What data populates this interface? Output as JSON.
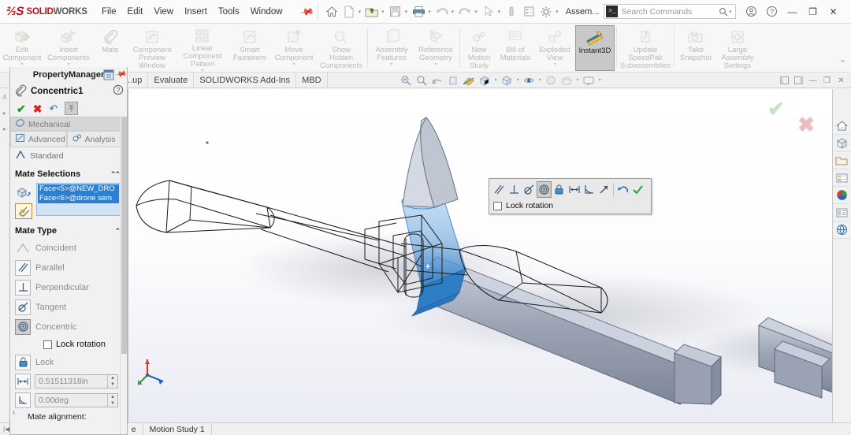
{
  "app": {
    "brand_solid": "SOLID",
    "brand_works": "WORKS",
    "brand_mark": "⅔S",
    "document_name": "Assem...",
    "accent_red": "#b4151c",
    "accent_blue": "#2f7fd0",
    "selection_blue": "#cfe4f7"
  },
  "menu": {
    "items": [
      {
        "label": "File"
      },
      {
        "label": "Edit"
      },
      {
        "label": "View"
      },
      {
        "label": "Insert"
      },
      {
        "label": "Tools"
      },
      {
        "label": "Window"
      }
    ],
    "pin_icon": "pushpin-icon"
  },
  "quickaccess": {
    "buttons": [
      {
        "name": "home-icon",
        "label": "Home",
        "caret": false
      },
      {
        "name": "new-document-icon",
        "label": "New",
        "caret": true
      },
      {
        "name": "open-folder-icon",
        "label": "Open",
        "caret": true
      },
      {
        "name": "save-icon",
        "label": "Save",
        "caret": true
      },
      {
        "name": "print-icon",
        "label": "Print",
        "caret": true
      },
      {
        "name": "undo-icon",
        "label": "Undo",
        "caret": true
      },
      {
        "name": "redo-icon",
        "label": "Redo",
        "caret": true
      },
      {
        "name": "select-arrow-icon",
        "label": "Select",
        "caret": true
      },
      {
        "name": "rebuild-icon",
        "label": "Rebuild",
        "caret": false
      },
      {
        "name": "file-properties-icon",
        "label": "File Properties",
        "caret": false
      },
      {
        "name": "options-gear-icon",
        "label": "Options",
        "caret": true
      }
    ]
  },
  "search": {
    "placeholder": "Search Commands",
    "prompt_glyph": "▶_",
    "magnifier": "search-icon",
    "caret": "▾"
  },
  "window_controls": {
    "account": "user-account-icon",
    "help": "help-icon",
    "minimize": "minimize-icon",
    "restore": "restore-icon",
    "close": "close-icon"
  },
  "ribbon": {
    "groups": [
      {
        "buttons": [
          {
            "name": "edit-component-button",
            "label": "Edit\nComponent",
            "icon": "edit-component-icon",
            "dropdown": true,
            "active": false
          },
          {
            "name": "insert-components-button",
            "label": "Insert\nComponents",
            "icon": "insert-components-icon",
            "dropdown": true,
            "active": false
          },
          {
            "name": "mate-button",
            "label": "Mate",
            "icon": "mate-paperclip-icon",
            "dropdown": false,
            "active": false
          },
          {
            "name": "component-preview-window-button",
            "label": "Component\nPreview\nWindow",
            "icon": "component-preview-icon",
            "dropdown": false,
            "active": false
          },
          {
            "name": "linear-component-pattern-button",
            "label": "Linear Component\nPattern",
            "icon": "linear-pattern-icon",
            "dropdown": true,
            "active": false
          },
          {
            "name": "smart-fasteners-button",
            "label": "Smart\nFasteners",
            "icon": "smart-fasteners-icon",
            "dropdown": false,
            "active": false
          },
          {
            "name": "move-component-button",
            "label": "Move\nComponent",
            "icon": "move-component-icon",
            "dropdown": true,
            "active": false
          },
          {
            "name": "show-hidden-components-button",
            "label": "Show\nHidden\nComponents",
            "icon": "show-hidden-icon",
            "dropdown": false,
            "active": false
          }
        ]
      },
      {
        "buttons": [
          {
            "name": "assembly-features-button",
            "label": "Assembly\nFeatures",
            "icon": "assembly-features-icon",
            "dropdown": true,
            "active": false
          },
          {
            "name": "reference-geometry-button",
            "label": "Reference\nGeometry",
            "icon": "reference-geometry-icon",
            "dropdown": true,
            "active": false
          }
        ]
      },
      {
        "buttons": [
          {
            "name": "new-motion-study-button",
            "label": "New\nMotion\nStudy",
            "icon": "motion-study-icon",
            "dropdown": false,
            "active": false
          },
          {
            "name": "bill-of-materials-button",
            "label": "Bill of\nMaterials",
            "icon": "bom-icon",
            "dropdown": false,
            "active": false
          },
          {
            "name": "exploded-view-button",
            "label": "Exploded\nView",
            "icon": "exploded-view-icon",
            "dropdown": true,
            "active": false
          },
          {
            "name": "instant3d-button",
            "label": "Instant3D",
            "icon": "instant3d-icon",
            "dropdown": false,
            "active": true
          }
        ]
      },
      {
        "buttons": [
          {
            "name": "update-speedpak-subassemblies-button",
            "label": "Update\nSpeedPak\nSubassemblies",
            "icon": "speedpak-icon",
            "dropdown": false,
            "active": false
          }
        ]
      },
      {
        "buttons": [
          {
            "name": "take-snapshot-button",
            "label": "Take\nSnapshot",
            "icon": "camera-icon",
            "dropdown": false,
            "active": false
          },
          {
            "name": "large-assembly-settings-button",
            "label": "Large\nAssembly\nSettings",
            "icon": "large-assembly-icon",
            "dropdown": false,
            "active": false
          }
        ]
      }
    ],
    "collapse_chevron": "⌃"
  },
  "command_tabs": {
    "tabs": [
      {
        "name": "tab-layout",
        "label": "...up"
      },
      {
        "name": "tab-evaluate",
        "label": "Evaluate"
      },
      {
        "name": "tab-solidworks-addins",
        "label": "SOLIDWORKS Add-Ins"
      },
      {
        "name": "tab-mbd",
        "label": "MBD"
      }
    ],
    "view_tools": [
      {
        "name": "zoom-to-fit-icon",
        "caret": false
      },
      {
        "name": "zoom-to-area-icon",
        "caret": false
      },
      {
        "name": "rotate-view-icon",
        "caret": false
      },
      {
        "name": "previous-view-icon",
        "caret": false
      },
      {
        "name": "section-view-icon",
        "caret": false
      },
      {
        "name": "view-orientation-icon",
        "caret": true
      },
      {
        "name": "display-style-icon",
        "caret": true
      },
      {
        "name": "hide-show-items-icon",
        "caret": true
      },
      {
        "name": "edit-appearance-icon",
        "caret": false
      },
      {
        "name": "apply-scene-icon",
        "caret": true
      },
      {
        "name": "view-settings-icon",
        "caret": true
      }
    ],
    "doc_window_controls": [
      {
        "name": "tile-left-icon"
      },
      {
        "name": "tile-right-icon"
      },
      {
        "name": "doc-minimize-icon",
        "glyph": "—"
      },
      {
        "name": "doc-restore-icon",
        "glyph": "❐"
      },
      {
        "name": "doc-close-icon",
        "glyph": "✕"
      }
    ]
  },
  "property_manager": {
    "header": "PropertyManager",
    "feature_name": "Concentric1",
    "feature_icon": "mate-paperclip-icon",
    "header_icons": {
      "display": "pm-display-icon",
      "pin": "pushpin-icon",
      "help": "help-question-icon"
    },
    "actions": [
      {
        "name": "accept-button",
        "glyph": "✔",
        "title": "OK"
      },
      {
        "name": "cancel-button",
        "glyph": "✖",
        "title": "Cancel"
      },
      {
        "name": "undo-button",
        "glyph": "↶",
        "title": "Undo"
      },
      {
        "name": "keep-visible-button",
        "glyph": "📌",
        "title": "Keep Visible"
      }
    ],
    "mate_tabs": [
      {
        "name": "tab-mechanical",
        "label": "Mechanical",
        "selected": true
      },
      {
        "name": "tab-advanced",
        "label": "Advanced",
        "selected": false
      },
      {
        "name": "tab-analysis",
        "label": "Analysis",
        "selected": false
      },
      {
        "name": "tab-standard",
        "label": "Standard",
        "selected": false
      }
    ],
    "mate_selections": {
      "title": "Mate Selections",
      "entities": [
        {
          "name": "mate-entity-1",
          "label": "Face<5>@NEW_DRO"
        },
        {
          "name": "mate-entity-2",
          "label": "Face<6>@drone sem"
        }
      ]
    },
    "mate_type": {
      "title": "Mate Type",
      "items": [
        {
          "name": "mate-coincident",
          "label": "Coincident",
          "icon": "coincident-icon",
          "selected": false,
          "boxed": false
        },
        {
          "name": "mate-parallel",
          "label": "Parallel",
          "icon": "parallel-icon",
          "selected": false,
          "boxed": true
        },
        {
          "name": "mate-perpendicular",
          "label": "Perpendicular",
          "icon": "perpendicular-icon",
          "selected": false,
          "boxed": true
        },
        {
          "name": "mate-tangent",
          "label": "Tangent",
          "icon": "tangent-icon",
          "selected": false,
          "boxed": true
        },
        {
          "name": "mate-concentric",
          "label": "Concentric",
          "icon": "concentric-icon",
          "selected": true,
          "boxed": true
        }
      ],
      "lock_rotation": {
        "label": "Lock rotation",
        "checked": false
      },
      "lock": {
        "label": "Lock",
        "icon": "padlock-icon"
      },
      "distance": {
        "value": "0.51511318in",
        "icon": "distance-icon"
      },
      "angle": {
        "value": "0.00deg",
        "icon": "angle-icon"
      },
      "mate_alignment_label": "Mate alignment:"
    }
  },
  "context_toolbar": {
    "buttons": [
      {
        "name": "ctx-parallel",
        "icon": "parallel-icon",
        "active": false
      },
      {
        "name": "ctx-perpendicular",
        "icon": "perpendicular-icon",
        "active": false
      },
      {
        "name": "ctx-tangent",
        "icon": "tangent-icon",
        "active": false
      },
      {
        "name": "ctx-concentric",
        "icon": "concentric-icon",
        "active": true
      },
      {
        "name": "ctx-lock",
        "icon": "padlock-icon",
        "active": false
      },
      {
        "name": "ctx-distance",
        "icon": "distance-icon",
        "active": false
      },
      {
        "name": "ctx-angle",
        "icon": "angle-icon",
        "active": false
      },
      {
        "name": "ctx-align",
        "icon": "align-arrow-icon",
        "active": false
      },
      {
        "name": "ctx-undo",
        "icon": "undo-icon",
        "active": false
      },
      {
        "name": "ctx-accept",
        "icon": "checkmark-icon",
        "active": false
      }
    ],
    "lock_rotation": {
      "label": "Lock rotation",
      "checked": false
    }
  },
  "graphics": {
    "confirm_ok": "✔",
    "confirm_cancel": "✖",
    "triad": {
      "x": "x",
      "y": "y",
      "z": "z"
    }
  },
  "task_pane": {
    "items": [
      {
        "name": "taskpane-home-icon"
      },
      {
        "name": "taskpane-design-library-icon"
      },
      {
        "name": "taskpane-file-explorer-icon"
      },
      {
        "name": "taskpane-view-palette-icon"
      },
      {
        "name": "taskpane-appearances-icon"
      },
      {
        "name": "taskpane-custom-properties-icon"
      },
      {
        "name": "taskpane-3dexperience-icon"
      }
    ]
  },
  "status_bar": {
    "tabs": [
      {
        "name": "status-tab-model",
        "label": "e",
        "selected": false
      },
      {
        "name": "status-tab-motion-study",
        "label": "Motion Study 1",
        "selected": false
      }
    ]
  }
}
